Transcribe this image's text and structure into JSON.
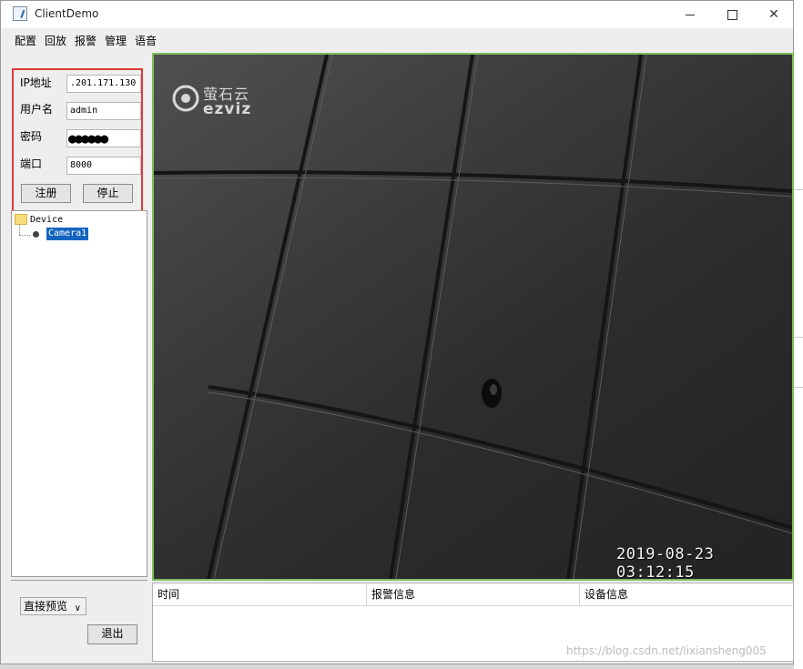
{
  "window": {
    "title": "ClientDemo",
    "controls": {
      "minimize": "—",
      "maximize": "☐",
      "close": "✕"
    }
  },
  "menu": [
    "配置",
    "回放",
    "报警",
    "管理",
    "语音"
  ],
  "login": {
    "ip_label": "IP地址",
    "ip_value": ".201.171.130",
    "user_label": "用户名",
    "user_value": "admin",
    "password_label": "密码",
    "password_value": "●●●●●●",
    "port_label": "端口",
    "port_value": "8000",
    "register_button": "注册",
    "stop_button": "停止"
  },
  "tree": {
    "root": "Device",
    "child": "Camera1"
  },
  "bottom_left": {
    "preview_select": "直接预览",
    "exit_button": "退出"
  },
  "video": {
    "logo_cn": "萤石云",
    "logo_en": "ezviz",
    "timestamp": "2019-08-23 03:12:15"
  },
  "alarm_table": {
    "columns": [
      "时间",
      "报警信息",
      "设备信息"
    ]
  },
  "watermark": "https://blog.csdn.net/lixiansheng005",
  "colors": {
    "highlight_border": "#e53935",
    "selection": "#1565c0",
    "video_border": "#7cbf5a"
  }
}
